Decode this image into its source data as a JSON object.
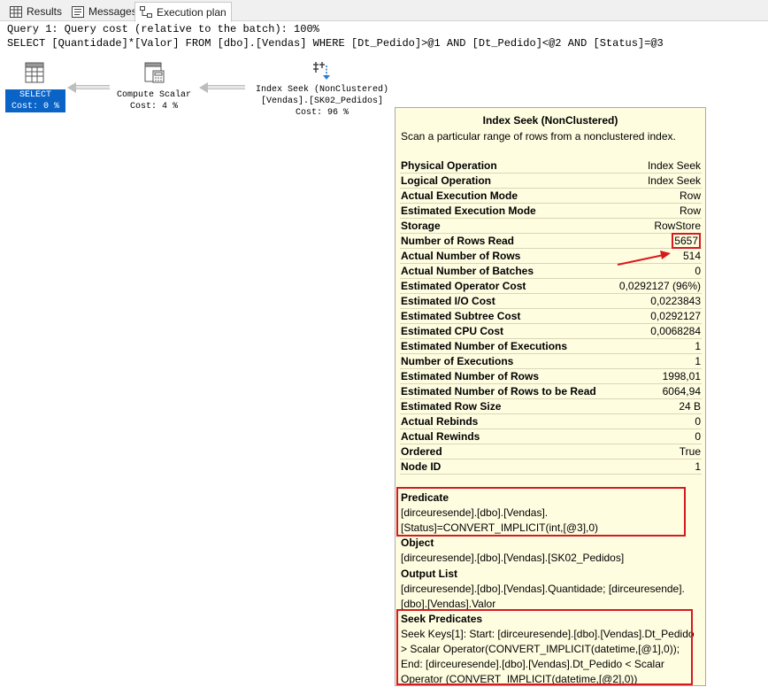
{
  "tabs": [
    {
      "label": "Results",
      "icon": "grid-icon"
    },
    {
      "label": "Messages",
      "icon": "messages-icon"
    },
    {
      "label": "Execution plan",
      "icon": "execution-plan-icon"
    }
  ],
  "query": {
    "header": "Query 1: Query cost (relative to the batch): 100%",
    "sql": "SELECT [Quantidade]*[Valor] FROM [dbo].[Vendas] WHERE [Dt_Pedido]>@1 AND [Dt_Pedido]<@2 AND [Status]=@3"
  },
  "plan": {
    "select": {
      "line1": "SELECT",
      "line2": "Cost: 0 %"
    },
    "compute_scalar": {
      "line1": "Compute Scalar",
      "line2": "Cost: 4 %"
    },
    "index_seek": {
      "line1": "Index Seek (NonClustered)",
      "line2": "[Vendas].[SK02_Pedidos]",
      "line3": "Cost: 96 %"
    }
  },
  "tooltip": {
    "title": "Index Seek (NonClustered)",
    "description": "Scan a particular range of rows from a nonclustered index.",
    "rows": [
      {
        "key": "Physical Operation",
        "value": "Index Seek"
      },
      {
        "key": "Logical Operation",
        "value": "Index Seek"
      },
      {
        "key": "Actual Execution Mode",
        "value": "Row"
      },
      {
        "key": "Estimated Execution Mode",
        "value": "Row"
      },
      {
        "key": "Storage",
        "value": "RowStore"
      },
      {
        "key": "Number of Rows Read",
        "value": "5657"
      },
      {
        "key": "Actual Number of Rows",
        "value": "514"
      },
      {
        "key": "Actual Number of Batches",
        "value": "0"
      },
      {
        "key": "Estimated Operator Cost",
        "value": "0,0292127 (96%)"
      },
      {
        "key": "Estimated I/O Cost",
        "value": "0,0223843"
      },
      {
        "key": "Estimated Subtree Cost",
        "value": "0,0292127"
      },
      {
        "key": "Estimated CPU Cost",
        "value": "0,0068284"
      },
      {
        "key": "Estimated Number of Executions",
        "value": "1"
      },
      {
        "key": "Number of Executions",
        "value": "1"
      },
      {
        "key": "Estimated Number of Rows",
        "value": "1998,01"
      },
      {
        "key": "Estimated Number of Rows to be Read",
        "value": "6064,94"
      },
      {
        "key": "Estimated Row Size",
        "value": "24 B"
      },
      {
        "key": "Actual Rebinds",
        "value": "0"
      },
      {
        "key": "Actual Rewinds",
        "value": "0"
      },
      {
        "key": "Ordered",
        "value": "True"
      },
      {
        "key": "Node ID",
        "value": "1"
      }
    ],
    "predicate": {
      "heading": "Predicate",
      "text": "[dirceuresende].[dbo].[Vendas].[Status]=CONVERT_IMPLICIT(int,[@3],0)"
    },
    "object": {
      "heading": "Object",
      "text": "[dirceuresende].[dbo].[Vendas].[SK02_Pedidos]"
    },
    "output_list": {
      "heading": "Output List",
      "text": "[dirceuresende].[dbo].[Vendas].Quantidade; [dirceuresende].[dbo].[Vendas].Valor"
    },
    "seek_predicates": {
      "heading": "Seek Predicates",
      "text": "Seek Keys[1]: Start: [dirceuresende].[dbo].[Vendas].Dt_Pedido > Scalar Operator(CONVERT_IMPLICIT(datetime,[@1],0)); End: [dirceuresende].[dbo].[Vendas].Dt_Pedido < Scalar Operator (CONVERT_IMPLICIT(datetime,[@2],0))"
    }
  },
  "colors": {
    "select_highlight": "#0a63c6",
    "tooltip_bg": "#fffde0",
    "annotation_red": "#d71920"
  }
}
